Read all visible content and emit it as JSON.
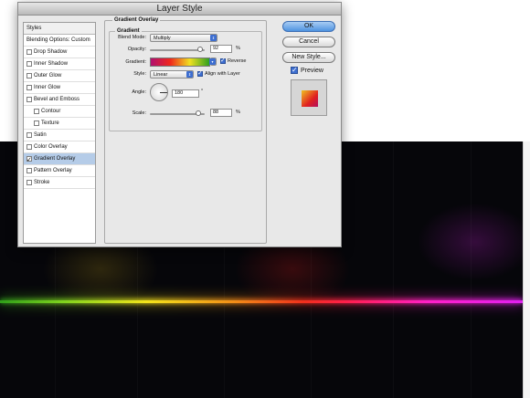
{
  "dialog": {
    "title": "Layer Style"
  },
  "styles_list": {
    "header": "Styles",
    "blending_options": "Blending Options: Custom",
    "items": [
      {
        "label": "Drop Shadow",
        "checked": false,
        "sub": false,
        "selected": false
      },
      {
        "label": "Inner Shadow",
        "checked": false,
        "sub": false,
        "selected": false
      },
      {
        "label": "Outer Glow",
        "checked": false,
        "sub": false,
        "selected": false
      },
      {
        "label": "Inner Glow",
        "checked": false,
        "sub": false,
        "selected": false
      },
      {
        "label": "Bevel and Emboss",
        "checked": false,
        "sub": false,
        "selected": false
      },
      {
        "label": "Contour",
        "checked": false,
        "sub": true,
        "selected": false
      },
      {
        "label": "Texture",
        "checked": false,
        "sub": true,
        "selected": false
      },
      {
        "label": "Satin",
        "checked": false,
        "sub": false,
        "selected": false
      },
      {
        "label": "Color Overlay",
        "checked": false,
        "sub": false,
        "selected": false
      },
      {
        "label": "Gradient Overlay",
        "checked": true,
        "sub": false,
        "selected": true
      },
      {
        "label": "Pattern Overlay",
        "checked": false,
        "sub": false,
        "selected": false
      },
      {
        "label": "Stroke",
        "checked": false,
        "sub": false,
        "selected": false
      }
    ]
  },
  "gradient_overlay": {
    "section_title": "Gradient Overlay",
    "group_title": "Gradient",
    "blend_mode_label": "Blend Mode:",
    "blend_mode": "Multiply",
    "opacity_label": "Opacity:",
    "opacity": "92",
    "opacity_unit": "%",
    "opacity_fraction": 0.92,
    "gradient_label": "Gradient:",
    "reverse_label": "Reverse",
    "reverse_checked": true,
    "style_label": "Style:",
    "style": "Linear",
    "align_label": "Align with Layer",
    "align_checked": true,
    "angle_label": "Angle:",
    "angle": "180",
    "angle_unit": "°",
    "scale_label": "Scale:",
    "scale": "88",
    "scale_unit": "%",
    "scale_fraction": 0.88
  },
  "buttons": {
    "ok": "OK",
    "cancel": "Cancel",
    "new_style": "New Style...",
    "preview_label": "Preview",
    "preview_checked": true
  },
  "colors": {
    "accent_blue": "#3d6ed0",
    "selected_row": "#b5cce8",
    "canvas_bg": "#06060a"
  }
}
